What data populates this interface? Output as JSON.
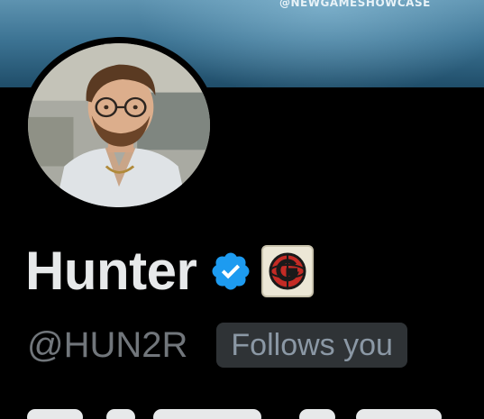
{
  "banner": {
    "handle_text": "@NEWGAMESHOWCASE"
  },
  "profile": {
    "display_name": "Hunter",
    "handle": "@HUN2R",
    "follows_badge": "Follows you",
    "verified_icon": "verified-badge-icon",
    "affiliation_icon": "affiliation-g-logo-icon",
    "colors": {
      "verified": "#1d9bf0",
      "name": "#e7e9ea",
      "handle": "#71767b",
      "badge_bg": "#2f3336"
    }
  }
}
